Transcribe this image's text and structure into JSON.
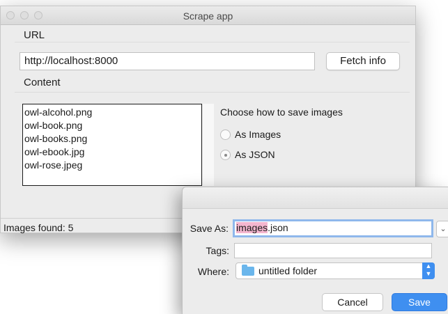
{
  "window": {
    "title": "Scrape app"
  },
  "url_section": {
    "label": "URL",
    "value": "http://localhost:8000",
    "fetch_button": "Fetch info"
  },
  "content_section": {
    "label": "Content",
    "files": [
      "owl-alcohol.png",
      "owl-book.png",
      "owl-books.png",
      "owl-ebook.jpg",
      "owl-rose.jpeg"
    ]
  },
  "save_options": {
    "title": "Choose how to save images",
    "option_images": "As Images",
    "option_json": "As JSON",
    "selected": "As JSON"
  },
  "status": {
    "text": "Images found: 5"
  },
  "save_dialog": {
    "save_as_label": "Save As:",
    "filename_selected": "images",
    "filename_rest": ".json",
    "tags_label": "Tags:",
    "tags_value": "",
    "where_label": "Where:",
    "where_value": "untitled folder",
    "cancel_label": "Cancel",
    "save_label": "Save",
    "accent_color": "#3f8ff0"
  }
}
